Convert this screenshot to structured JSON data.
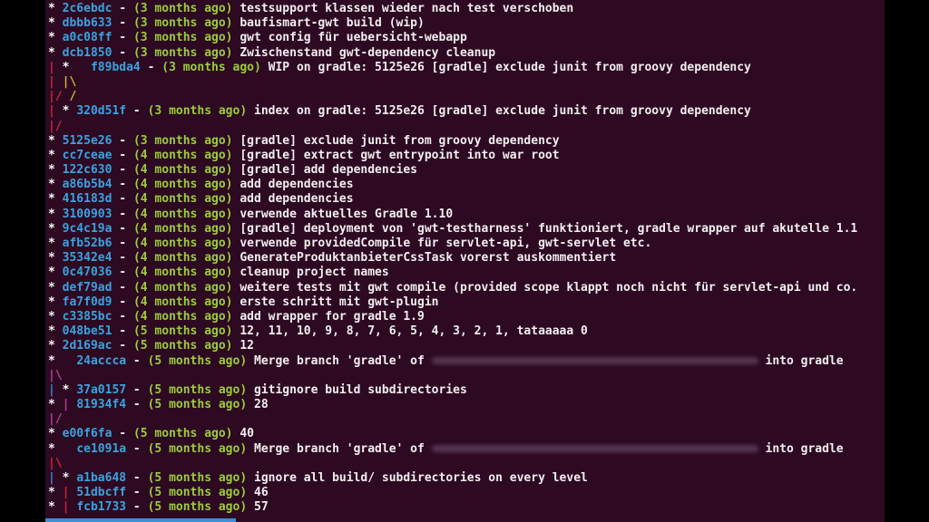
{
  "lines": [
    {
      "gutter": [
        {
          "t": "* ",
          "c": "g"
        }
      ],
      "hash": "2c6ebdc",
      "date": "(3 months ago)",
      "msg": "testsupport klassen wieder nach test verschoben"
    },
    {
      "gutter": [
        {
          "t": "* ",
          "c": "g"
        }
      ],
      "hash": "dbbb633",
      "date": "(3 months ago)",
      "msg": "baufismart-gwt build (wip)"
    },
    {
      "gutter": [
        {
          "t": "* ",
          "c": "g"
        }
      ],
      "hash": "a0c08ff",
      "date": "(3 months ago)",
      "msg": "gwt config für uebersicht-webapp"
    },
    {
      "gutter": [
        {
          "t": "* ",
          "c": "g"
        }
      ],
      "hash": "dcb1850",
      "date": "(3 months ago)",
      "msg": "Zwischenstand gwt-dependency cleanup"
    },
    {
      "gutter": [
        {
          "t": "| ",
          "c": "branch-r"
        },
        {
          "t": "*   ",
          "c": "g"
        }
      ],
      "hash": "f89bda4",
      "date": "(3 months ago)",
      "msg": "WIP on gradle: 5125e26 [gradle] exclude junit from groovy dependency"
    },
    {
      "gutter": [
        {
          "t": "| ",
          "c": "branch-r"
        },
        {
          "t": "|\\",
          "c": "branch-y"
        }
      ]
    },
    {
      "gutter": [
        {
          "t": "|/ ",
          "c": "branch-r"
        },
        {
          "t": "/",
          "c": "branch-y"
        }
      ]
    },
    {
      "gutter": [
        {
          "t": "| ",
          "c": "branch-r"
        },
        {
          "t": "* ",
          "c": "g"
        }
      ],
      "hash": "320d51f",
      "date": "(3 months ago)",
      "msg": "index on gradle: 5125e26 [gradle] exclude junit from groovy dependency"
    },
    {
      "gutter": [
        {
          "t": "|/",
          "c": "branch-r"
        }
      ]
    },
    {
      "gutter": [
        {
          "t": "* ",
          "c": "g"
        }
      ],
      "hash": "5125e26",
      "date": "(3 months ago)",
      "msg": "[gradle] exclude junit from groovy dependency"
    },
    {
      "gutter": [
        {
          "t": "* ",
          "c": "g"
        }
      ],
      "hash": "cc7ceae",
      "date": "(4 months ago)",
      "msg": "[gradle] extract gwt entrypoint into war root"
    },
    {
      "gutter": [
        {
          "t": "* ",
          "c": "g"
        }
      ],
      "hash": "122c630",
      "date": "(4 months ago)",
      "msg": "[gradle] add dependencies"
    },
    {
      "gutter": [
        {
          "t": "* ",
          "c": "g"
        }
      ],
      "hash": "a86b5b4",
      "date": "(4 months ago)",
      "msg": "add dependencies"
    },
    {
      "gutter": [
        {
          "t": "* ",
          "c": "g"
        }
      ],
      "hash": "416183d",
      "date": "(4 months ago)",
      "msg": "add dependencies"
    },
    {
      "gutter": [
        {
          "t": "* ",
          "c": "g"
        }
      ],
      "hash": "3100903",
      "date": "(4 months ago)",
      "msg": "verwende aktuelles Gradle 1.10"
    },
    {
      "gutter": [
        {
          "t": "* ",
          "c": "g"
        }
      ],
      "hash": "9c4c19a",
      "date": "(4 months ago)",
      "msg": "[gradle] deployment von 'gwt-testharness' funktioniert, gradle wrapper auf akutelle 1.1"
    },
    {
      "gutter": [
        {
          "t": "* ",
          "c": "g"
        }
      ],
      "hash": "afb52b6",
      "date": "(4 months ago)",
      "msg": "verwende providedCompile für servlet-api, gwt-servlet etc."
    },
    {
      "gutter": [
        {
          "t": "* ",
          "c": "g"
        }
      ],
      "hash": "35342e4",
      "date": "(4 months ago)",
      "msg": "GenerateProduktanbieterCssTask vorerst auskommentiert"
    },
    {
      "gutter": [
        {
          "t": "* ",
          "c": "g"
        }
      ],
      "hash": "0c47036",
      "date": "(4 months ago)",
      "msg": "cleanup project names"
    },
    {
      "gutter": [
        {
          "t": "* ",
          "c": "g"
        }
      ],
      "hash": "def79ad",
      "date": "(4 months ago)",
      "msg": "weitere tests mit gwt compile (provided scope klappt noch nicht für servlet-api und co."
    },
    {
      "gutter": [
        {
          "t": "* ",
          "c": "g"
        }
      ],
      "hash": "fa7f0d9",
      "date": "(4 months ago)",
      "msg": "erste schritt mit gwt-plugin"
    },
    {
      "gutter": [
        {
          "t": "* ",
          "c": "g"
        }
      ],
      "hash": "c3385bc",
      "date": "(4 months ago)",
      "msg": "add wrapper for gradle 1.9"
    },
    {
      "gutter": [
        {
          "t": "* ",
          "c": "g"
        }
      ],
      "hash": "048be51",
      "date": "(5 months ago)",
      "msg": "12, 11, 10, 9, 8, 7, 6, 5, 4, 3, 2, 1, tataaaaa 0"
    },
    {
      "gutter": [
        {
          "t": "* ",
          "c": "g"
        }
      ],
      "hash": "2d169ac",
      "date": "(5 months ago)",
      "msg": "12"
    },
    {
      "gutter": [
        {
          "t": "*   ",
          "c": "g"
        }
      ],
      "hash": "24accca",
      "date": "(5 months ago)",
      "msg": "Merge branch 'gradle' of",
      "blur": true,
      "msg2": "into gradle"
    },
    {
      "gutter": [
        {
          "t": "|\\",
          "c": "branch-m"
        }
      ]
    },
    {
      "gutter": [
        {
          "t": "| ",
          "c": "branch-b"
        },
        {
          "t": "* ",
          "c": "g"
        }
      ],
      "hash": "37a0157",
      "date": "(5 months ago)",
      "msg": "gitignore build subdirectories"
    },
    {
      "gutter": [
        {
          "t": "* ",
          "c": "g"
        },
        {
          "t": "| ",
          "c": "branch-m"
        }
      ],
      "hash": "81934f4",
      "date": "(5 months ago)",
      "msg": "28"
    },
    {
      "gutter": [
        {
          "t": "|/",
          "c": "branch-m"
        }
      ]
    },
    {
      "gutter": [
        {
          "t": "* ",
          "c": "g"
        }
      ],
      "hash": "e00f6fa",
      "date": "(5 months ago)",
      "msg": "40"
    },
    {
      "gutter": [
        {
          "t": "*   ",
          "c": "g"
        }
      ],
      "hash": "ce1091a",
      "date": "(5 months ago)",
      "msg": "Merge branch 'gradle' of",
      "blur": true,
      "msg2": "into gradle"
    },
    {
      "gutter": [
        {
          "t": "|\\",
          "c": "branch-r"
        }
      ]
    },
    {
      "gutter": [
        {
          "t": "| ",
          "c": "branch-b"
        },
        {
          "t": "* ",
          "c": "g"
        }
      ],
      "hash": "a1ba648",
      "date": "(5 months ago)",
      "msg": "ignore all build/ subdirectories on every level"
    },
    {
      "gutter": [
        {
          "t": "* ",
          "c": "g"
        },
        {
          "t": "| ",
          "c": "branch-r"
        }
      ],
      "hash": "51dbcff",
      "date": "(5 months ago)",
      "msg": "46"
    },
    {
      "gutter": [
        {
          "t": "* ",
          "c": "g"
        },
        {
          "t": "| ",
          "c": "branch-r"
        }
      ],
      "hash": "fcb1733",
      "date": "(5 months ago)",
      "msg": "57"
    }
  ]
}
